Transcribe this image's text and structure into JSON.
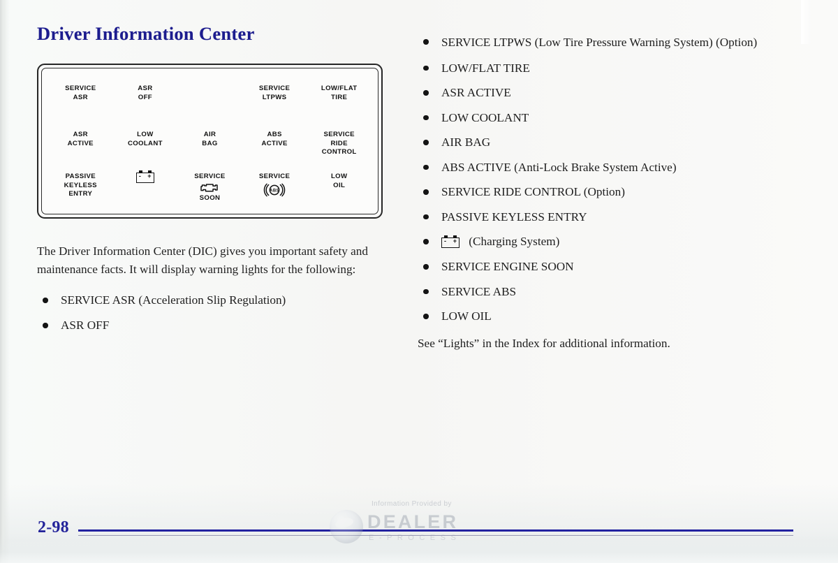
{
  "document": {
    "title": "Driver Information Center",
    "page_number": "2-98",
    "title_color": "#1c1c8e",
    "rule_color": "#2222a0"
  },
  "dic_diagram": {
    "name": "driver-information-center-display-panel",
    "rows": [
      [
        {
          "type": "text",
          "label": "SERVICE\nASR"
        },
        {
          "type": "text",
          "label": "ASR\nOFF"
        },
        {
          "type": "empty",
          "label": ""
        },
        {
          "type": "text",
          "label": "SERVICE\nLTPWS"
        },
        {
          "type": "text",
          "label": "LOW/FLAT\nTIRE"
        }
      ],
      [
        {
          "type": "text",
          "label": "ASR\nACTIVE"
        },
        {
          "type": "text",
          "label": "LOW\nCOOLANT"
        },
        {
          "type": "text",
          "label": "AIR\nBAG"
        },
        {
          "type": "text",
          "label": "ABS\nACTIVE"
        },
        {
          "type": "text",
          "label": "SERVICE\nRIDE\nCONTROL"
        }
      ],
      [
        {
          "type": "text",
          "label": "PASSIVE\nKEYLESS\nENTRY"
        },
        {
          "type": "icon",
          "icon": "battery-icon",
          "label": ""
        },
        {
          "type": "icon_text",
          "icon": "engine-icon",
          "label_top": "SERVICE",
          "label_bottom": "SOON"
        },
        {
          "type": "icon_text",
          "icon": "abs-icon",
          "label_top": "SERVICE",
          "label_bottom": ""
        },
        {
          "type": "text",
          "label": "LOW\nOIL"
        }
      ]
    ]
  },
  "left_column": {
    "description": "The Driver Information Center (DIC) gives you important safety and maintenance facts. It will display warning lights for the following:",
    "bullets": [
      "SERVICE ASR (Acceleration Slip Regulation)",
      "ASR OFF"
    ]
  },
  "right_column": {
    "bullets": [
      {
        "text": "SERVICE LTPWS (Low Tire Pressure Warning System) (Option)",
        "icon": null
      },
      {
        "text": "LOW/FLAT TIRE",
        "icon": null
      },
      {
        "text": "ASR ACTIVE",
        "icon": null
      },
      {
        "text": "LOW COOLANT",
        "icon": null
      },
      {
        "text": "AIR BAG",
        "icon": null
      },
      {
        "text": "ABS ACTIVE (Anti-Lock Brake System Active)",
        "icon": null
      },
      {
        "text": "SERVICE RIDE CONTROL (Option)",
        "icon": null
      },
      {
        "text": "PASSIVE KEYLESS ENTRY",
        "icon": null
      },
      {
        "text": "(Charging System)",
        "icon": "battery-icon"
      },
      {
        "text": "SERVICE ENGINE SOON",
        "icon": null
      },
      {
        "text": "SERVICE ABS",
        "icon": null
      },
      {
        "text": "LOW OIL",
        "icon": null
      }
    ],
    "note": "See “Lights” in the Index for additional information."
  },
  "watermark": {
    "caption": "Information Provided by",
    "brand": "DEALER",
    "subtitle": "E-PROCESS"
  }
}
